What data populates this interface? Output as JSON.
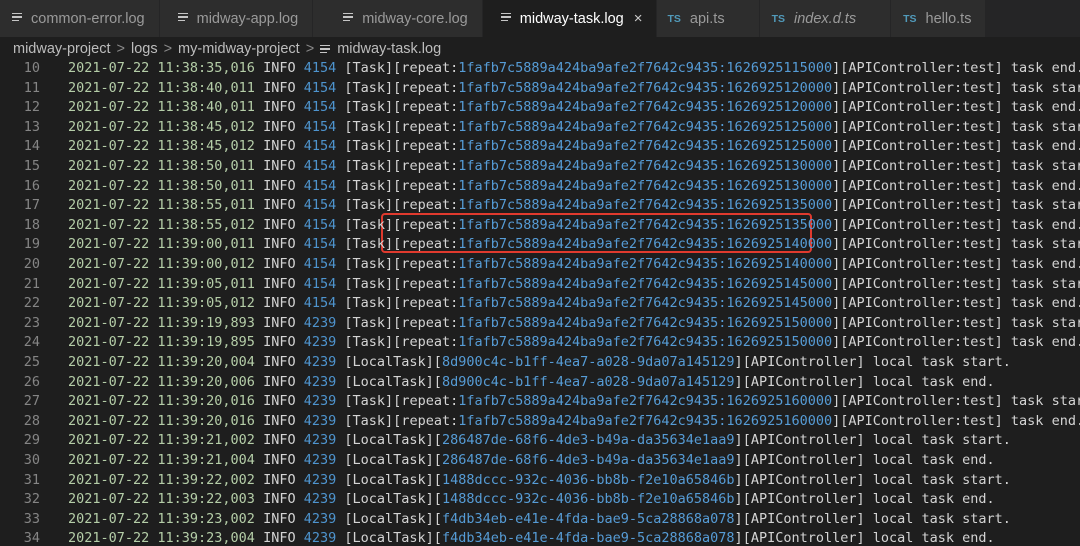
{
  "tabs": [
    {
      "label": "common-error.log",
      "icon": "log-file-icon",
      "active": false,
      "italic": false
    },
    {
      "label": "midway-app.log",
      "icon": "log-file-icon",
      "active": false,
      "italic": false
    },
    {
      "label": "midway-core.log",
      "icon": "log-file-icon",
      "active": false,
      "italic": false
    },
    {
      "label": "midway-task.log",
      "icon": "log-file-icon",
      "active": true,
      "italic": false
    },
    {
      "label": "api.ts",
      "icon": "typescript-icon",
      "icon_text": "TS",
      "active": false,
      "italic": false
    },
    {
      "label": "index.d.ts",
      "icon": "typescript-icon",
      "icon_text": "TS",
      "active": false,
      "italic": true
    },
    {
      "label": "hello.ts",
      "icon": "typescript-icon",
      "icon_text": "TS",
      "active": false,
      "italic": false
    }
  ],
  "close_glyph": "×",
  "breadcrumb": [
    "midway-project",
    "logs",
    "my-midway-project",
    "midway-task.log"
  ],
  "breadcrumb_separator": ">",
  "highlighted_lines": [
    18,
    19
  ],
  "lines": [
    {
      "n": "10",
      "date": "2021-07-22 11:38:35,016",
      "level": "INFO",
      "pid": "4154",
      "tag": "[Task]",
      "lb": "[",
      "key": "repeat:",
      "id": "1fafb7c5889a424ba9afe2f7642c9435:1626925115000",
      "rb": "]",
      "ctrl": "[APIController:test]",
      "msg": " task end."
    },
    {
      "n": "11",
      "date": "2021-07-22 11:38:40,011",
      "level": "INFO",
      "pid": "4154",
      "tag": "[Task]",
      "lb": "[",
      "key": "repeat:",
      "id": "1fafb7c5889a424ba9afe2f7642c9435:1626925120000",
      "rb": "]",
      "ctrl": "[APIController:test]",
      "msg": " task start."
    },
    {
      "n": "12",
      "date": "2021-07-22 11:38:40,011",
      "level": "INFO",
      "pid": "4154",
      "tag": "[Task]",
      "lb": "[",
      "key": "repeat:",
      "id": "1fafb7c5889a424ba9afe2f7642c9435:1626925120000",
      "rb": "]",
      "ctrl": "[APIController:test]",
      "msg": " task end."
    },
    {
      "n": "13",
      "date": "2021-07-22 11:38:45,012",
      "level": "INFO",
      "pid": "4154",
      "tag": "[Task]",
      "lb": "[",
      "key": "repeat:",
      "id": "1fafb7c5889a424ba9afe2f7642c9435:1626925125000",
      "rb": "]",
      "ctrl": "[APIController:test]",
      "msg": " task start."
    },
    {
      "n": "14",
      "date": "2021-07-22 11:38:45,012",
      "level": "INFO",
      "pid": "4154",
      "tag": "[Task]",
      "lb": "[",
      "key": "repeat:",
      "id": "1fafb7c5889a424ba9afe2f7642c9435:1626925125000",
      "rb": "]",
      "ctrl": "[APIController:test]",
      "msg": " task end."
    },
    {
      "n": "15",
      "date": "2021-07-22 11:38:50,011",
      "level": "INFO",
      "pid": "4154",
      "tag": "[Task]",
      "lb": "[",
      "key": "repeat:",
      "id": "1fafb7c5889a424ba9afe2f7642c9435:1626925130000",
      "rb": "]",
      "ctrl": "[APIController:test]",
      "msg": " task start."
    },
    {
      "n": "16",
      "date": "2021-07-22 11:38:50,011",
      "level": "INFO",
      "pid": "4154",
      "tag": "[Task]",
      "lb": "[",
      "key": "repeat:",
      "id": "1fafb7c5889a424ba9afe2f7642c9435:1626925130000",
      "rb": "]",
      "ctrl": "[APIController:test]",
      "msg": " task end."
    },
    {
      "n": "17",
      "date": "2021-07-22 11:38:55,011",
      "level": "INFO",
      "pid": "4154",
      "tag": "[Task]",
      "lb": "[",
      "key": "repeat:",
      "id": "1fafb7c5889a424ba9afe2f7642c9435:1626925135000",
      "rb": "]",
      "ctrl": "[APIController:test]",
      "msg": " task start."
    },
    {
      "n": "18",
      "date": "2021-07-22 11:38:55,012",
      "level": "INFO",
      "pid": "4154",
      "tag": "[Task]",
      "lb": "[",
      "key": "repeat:",
      "id": "1fafb7c5889a424ba9afe2f7642c9435:1626925135000",
      "rb": "]",
      "ctrl": "[APIController:test]",
      "msg": " task end."
    },
    {
      "n": "19",
      "date": "2021-07-22 11:39:00,011",
      "level": "INFO",
      "pid": "4154",
      "tag": "[Task]",
      "lb": "[",
      "key": "repeat:",
      "id": "1fafb7c5889a424ba9afe2f7642c9435:1626925140000",
      "rb": "]",
      "ctrl": "[APIController:test]",
      "msg": " task start."
    },
    {
      "n": "20",
      "date": "2021-07-22 11:39:00,012",
      "level": "INFO",
      "pid": "4154",
      "tag": "[Task]",
      "lb": "[",
      "key": "repeat:",
      "id": "1fafb7c5889a424ba9afe2f7642c9435:1626925140000",
      "rb": "]",
      "ctrl": "[APIController:test]",
      "msg": " task end."
    },
    {
      "n": "21",
      "date": "2021-07-22 11:39:05,011",
      "level": "INFO",
      "pid": "4154",
      "tag": "[Task]",
      "lb": "[",
      "key": "repeat:",
      "id": "1fafb7c5889a424ba9afe2f7642c9435:1626925145000",
      "rb": "]",
      "ctrl": "[APIController:test]",
      "msg": " task start."
    },
    {
      "n": "22",
      "date": "2021-07-22 11:39:05,012",
      "level": "INFO",
      "pid": "4154",
      "tag": "[Task]",
      "lb": "[",
      "key": "repeat:",
      "id": "1fafb7c5889a424ba9afe2f7642c9435:1626925145000",
      "rb": "]",
      "ctrl": "[APIController:test]",
      "msg": " task end."
    },
    {
      "n": "23",
      "date": "2021-07-22 11:39:19,893",
      "level": "INFO",
      "pid": "4239",
      "tag": "[Task]",
      "lb": "[",
      "key": "repeat:",
      "id": "1fafb7c5889a424ba9afe2f7642c9435:1626925150000",
      "rb": "]",
      "ctrl": "[APIController:test]",
      "msg": " task start."
    },
    {
      "n": "24",
      "date": "2021-07-22 11:39:19,895",
      "level": "INFO",
      "pid": "4239",
      "tag": "[Task]",
      "lb": "[",
      "key": "repeat:",
      "id": "1fafb7c5889a424ba9afe2f7642c9435:1626925150000",
      "rb": "]",
      "ctrl": "[APIController:test]",
      "msg": " task end."
    },
    {
      "n": "25",
      "date": "2021-07-22 11:39:20,004",
      "level": "INFO",
      "pid": "4239",
      "tag": "[LocalTask]",
      "lb": "[",
      "key": "",
      "id": "8d900c4c-b1ff-4ea7-a028-9da07a145129",
      "rb": "]",
      "ctrl": "[APIController]",
      "msg": " local task start."
    },
    {
      "n": "26",
      "date": "2021-07-22 11:39:20,006",
      "level": "INFO",
      "pid": "4239",
      "tag": "[LocalTask]",
      "lb": "[",
      "key": "",
      "id": "8d900c4c-b1ff-4ea7-a028-9da07a145129",
      "rb": "]",
      "ctrl": "[APIController]",
      "msg": " local task end."
    },
    {
      "n": "27",
      "date": "2021-07-22 11:39:20,016",
      "level": "INFO",
      "pid": "4239",
      "tag": "[Task]",
      "lb": "[",
      "key": "repeat:",
      "id": "1fafb7c5889a424ba9afe2f7642c9435:1626925160000",
      "rb": "]",
      "ctrl": "[APIController:test]",
      "msg": " task start."
    },
    {
      "n": "28",
      "date": "2021-07-22 11:39:20,016",
      "level": "INFO",
      "pid": "4239",
      "tag": "[Task]",
      "lb": "[",
      "key": "repeat:",
      "id": "1fafb7c5889a424ba9afe2f7642c9435:1626925160000",
      "rb": "]",
      "ctrl": "[APIController:test]",
      "msg": " task end."
    },
    {
      "n": "29",
      "date": "2021-07-22 11:39:21,002",
      "level": "INFO",
      "pid": "4239",
      "tag": "[LocalTask]",
      "lb": "[",
      "key": "",
      "id": "286487de-68f6-4de3-b49a-da35634e1aa9",
      "rb": "]",
      "ctrl": "[APIController]",
      "msg": " local task start."
    },
    {
      "n": "30",
      "date": "2021-07-22 11:39:21,004",
      "level": "INFO",
      "pid": "4239",
      "tag": "[LocalTask]",
      "lb": "[",
      "key": "",
      "id": "286487de-68f6-4de3-b49a-da35634e1aa9",
      "rb": "]",
      "ctrl": "[APIController]",
      "msg": " local task end."
    },
    {
      "n": "31",
      "date": "2021-07-22 11:39:22,002",
      "level": "INFO",
      "pid": "4239",
      "tag": "[LocalTask]",
      "lb": "[",
      "key": "",
      "id": "1488dccc-932c-4036-bb8b-f2e10a65846b",
      "rb": "]",
      "ctrl": "[APIController]",
      "msg": " local task start."
    },
    {
      "n": "32",
      "date": "2021-07-22 11:39:22,003",
      "level": "INFO",
      "pid": "4239",
      "tag": "[LocalTask]",
      "lb": "[",
      "key": "",
      "id": "1488dccc-932c-4036-bb8b-f2e10a65846b",
      "rb": "]",
      "ctrl": "[APIController]",
      "msg": " local task end."
    },
    {
      "n": "33",
      "date": "2021-07-22 11:39:23,002",
      "level": "INFO",
      "pid": "4239",
      "tag": "[LocalTask]",
      "lb": "[",
      "key": "",
      "id": "f4db34eb-e41e-4fda-bae9-5ca28868a078",
      "rb": "]",
      "ctrl": "[APIController]",
      "msg": " local task start."
    },
    {
      "n": "34",
      "date": "2021-07-22 11:39:23,004",
      "level": "INFO",
      "pid": "4239",
      "tag": "[LocalTask]",
      "lb": "[",
      "key": "",
      "id": "f4db34eb-e41e-4fda-bae9-5ca28868a078",
      "rb": "]",
      "ctrl": "[APIController]",
      "msg": " local task end."
    }
  ],
  "colors": {
    "editor_bg": "#1e1e1e",
    "tab_bar_bg": "#252526",
    "date": "#b5cea8",
    "pid": "#4e94ce",
    "uuid": "#569cd6",
    "line_number": "#858585",
    "highlight_box": "#e03a2e"
  }
}
